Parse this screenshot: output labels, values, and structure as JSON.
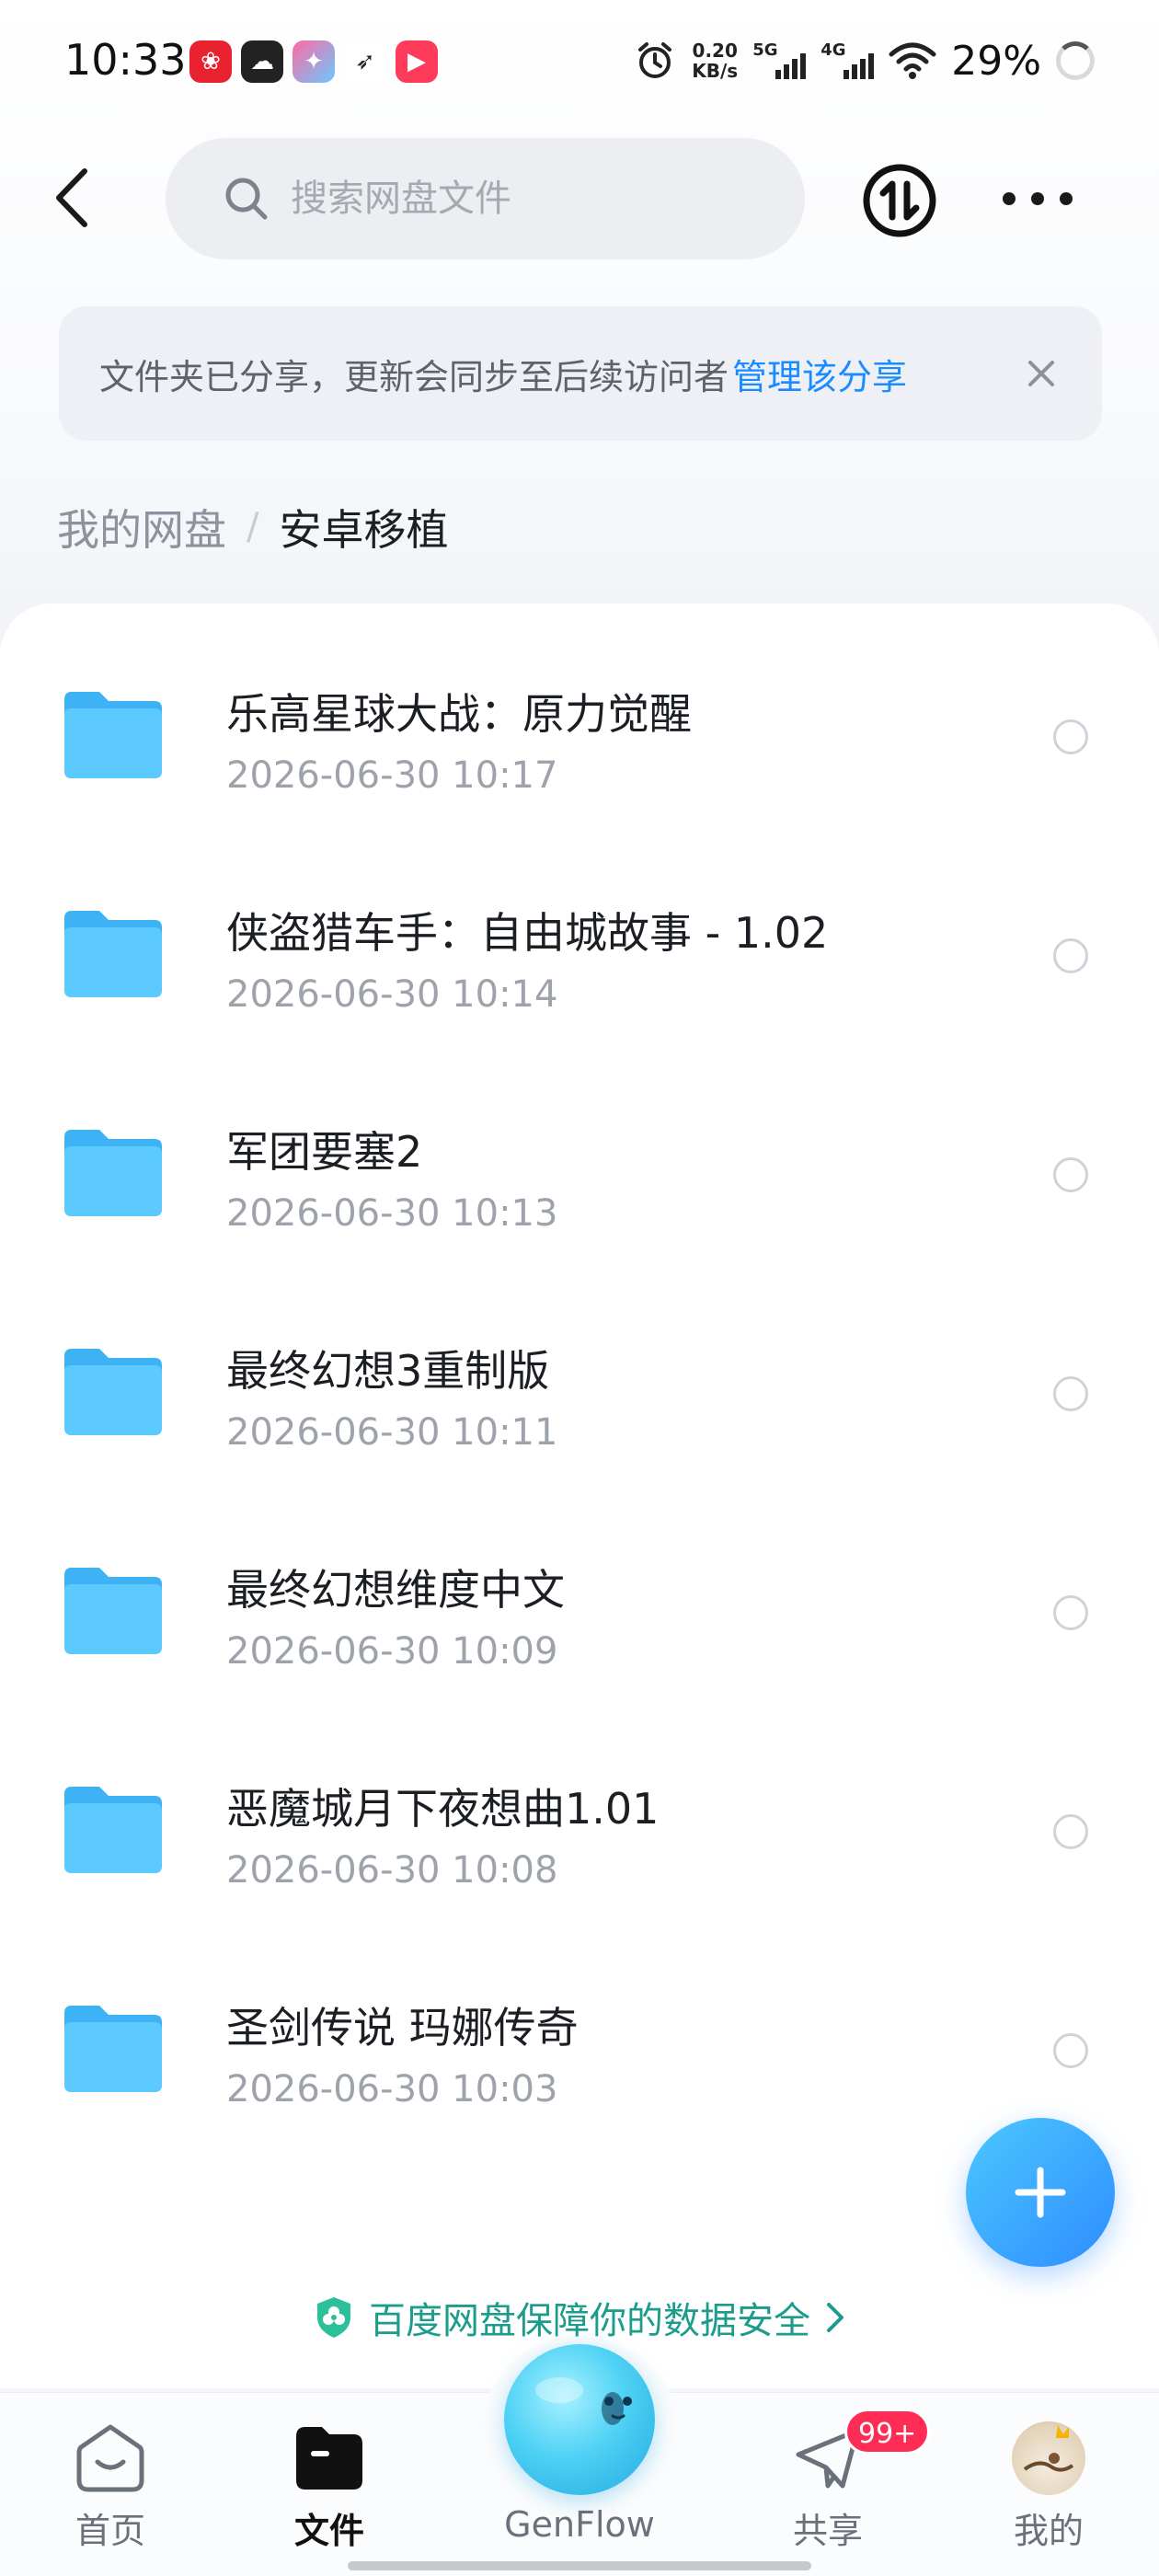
{
  "status_bar": {
    "time": "10:33",
    "net_speed_value": "0.20",
    "net_speed_unit": "KB/s",
    "sim1": "5G",
    "sim2": "4G",
    "battery": "29%"
  },
  "header": {
    "search_placeholder": "搜索网盘文件"
  },
  "banner": {
    "text": "文件夹已分享，更新会同步至后续访问者",
    "link": "管理该分享"
  },
  "breadcrumb": {
    "root": "我的网盘",
    "separator": "/",
    "current": "安卓移植"
  },
  "files": [
    {
      "name": "乐高星球大战：原力觉醒",
      "date": "2026-06-30  10:17"
    },
    {
      "name": "侠盗猎车手：自由城故事 - 1.02",
      "date": "2026-06-30  10:14"
    },
    {
      "name": "军团要塞2",
      "date": "2026-06-30  10:13"
    },
    {
      "name": "最终幻想3重制版",
      "date": "2026-06-30  10:11"
    },
    {
      "name": "最终幻想维度中文",
      "date": "2026-06-30  10:09"
    },
    {
      "name": "恶魔城月下夜想曲1.01",
      "date": "2026-06-30  10:08"
    },
    {
      "name": "圣剑传说 玛娜传奇",
      "date": "2026-06-30  10:03"
    }
  ],
  "security": {
    "text": "百度网盘保障你的数据安全"
  },
  "nav": {
    "home": "首页",
    "files": "文件",
    "genflow": "GenFlow",
    "share": "共享",
    "share_badge": "99+",
    "mine": "我的"
  },
  "colors": {
    "accent": "#1a8cff",
    "security_green": "#1c9d8c",
    "badge_red": "#ff2d55",
    "folder_blue": "#5cc9ff"
  }
}
